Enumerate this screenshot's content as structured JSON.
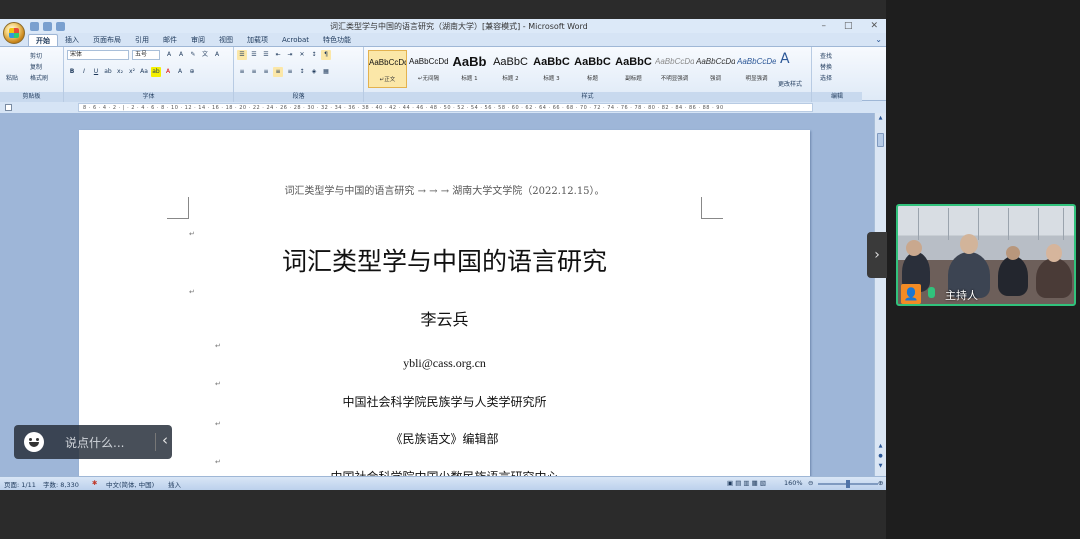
{
  "window": {
    "title": "词汇类型学与中国的语言研究（湖南大学）[兼容模式] - Microsoft Word",
    "controls": [
      "–",
      "□",
      "✕"
    ]
  },
  "ribbon": {
    "tabs": [
      "开始",
      "插入",
      "页面布局",
      "引用",
      "邮件",
      "审阅",
      "视图",
      "加载项",
      "Acrobat",
      "特色功能"
    ],
    "clipboard": {
      "paste": "粘贴",
      "cut": "剪切",
      "copy": "复制",
      "format_painter": "格式刷",
      "label": "剪贴板"
    },
    "font": {
      "name": "宋体",
      "size": "五号",
      "label": "字体"
    },
    "paragraph": {
      "label": "段落"
    },
    "styles": {
      "label": "样式",
      "items": [
        {
          "sample": "AaBbCcDd",
          "name": "↵正文",
          "kind": "normal"
        },
        {
          "sample": "AaBbCcDd",
          "name": "↵无间隔",
          "kind": "normal"
        },
        {
          "sample": "AaBb",
          "name": "标题 1",
          "kind": "big"
        },
        {
          "sample": "AaBbC",
          "name": "标题 2",
          "kind": "med"
        },
        {
          "sample": "AaBbC",
          "name": "标题 3",
          "kind": "med"
        },
        {
          "sample": "AaBbC",
          "name": "标题",
          "kind": "med"
        },
        {
          "sample": "AaBbC",
          "name": "副标题",
          "kind": "med"
        },
        {
          "sample": "AaBbCcDd",
          "name": "不明显强调",
          "kind": "light"
        },
        {
          "sample": "AaBbCcDd",
          "name": "强调",
          "kind": "light"
        },
        {
          "sample": "AaBbCcDe",
          "name": "明显强调",
          "kind": "light"
        }
      ],
      "change_styles": "更改样式"
    },
    "editing": {
      "find": "查找",
      "replace": "替换",
      "select": "选择",
      "label": "编辑"
    }
  },
  "document": {
    "header": "词汇类型学与中国的语言研究 →     →     →   湖南大学文学院（2022.12.15）。",
    "title": "词汇类型学与中国的语言研究",
    "author": "李云兵",
    "email": "ybli@cass.org.cn",
    "affiliation_1": "中国社会科学院民族学与人类学研究所",
    "affiliation_2": "《民族语文》编辑部",
    "affiliation_3": "中国社会科学院中国少数民族语言研究中心"
  },
  "statusbar": {
    "page": "页面: 1/11",
    "words": "字数: 8,330",
    "language": "中文(简体, 中国)",
    "mode": "插入",
    "zoom": "160%"
  },
  "meeting": {
    "speaker_name": "主持人",
    "chat_placeholder": "说点什么...",
    "accent_color": "#31c27c"
  }
}
